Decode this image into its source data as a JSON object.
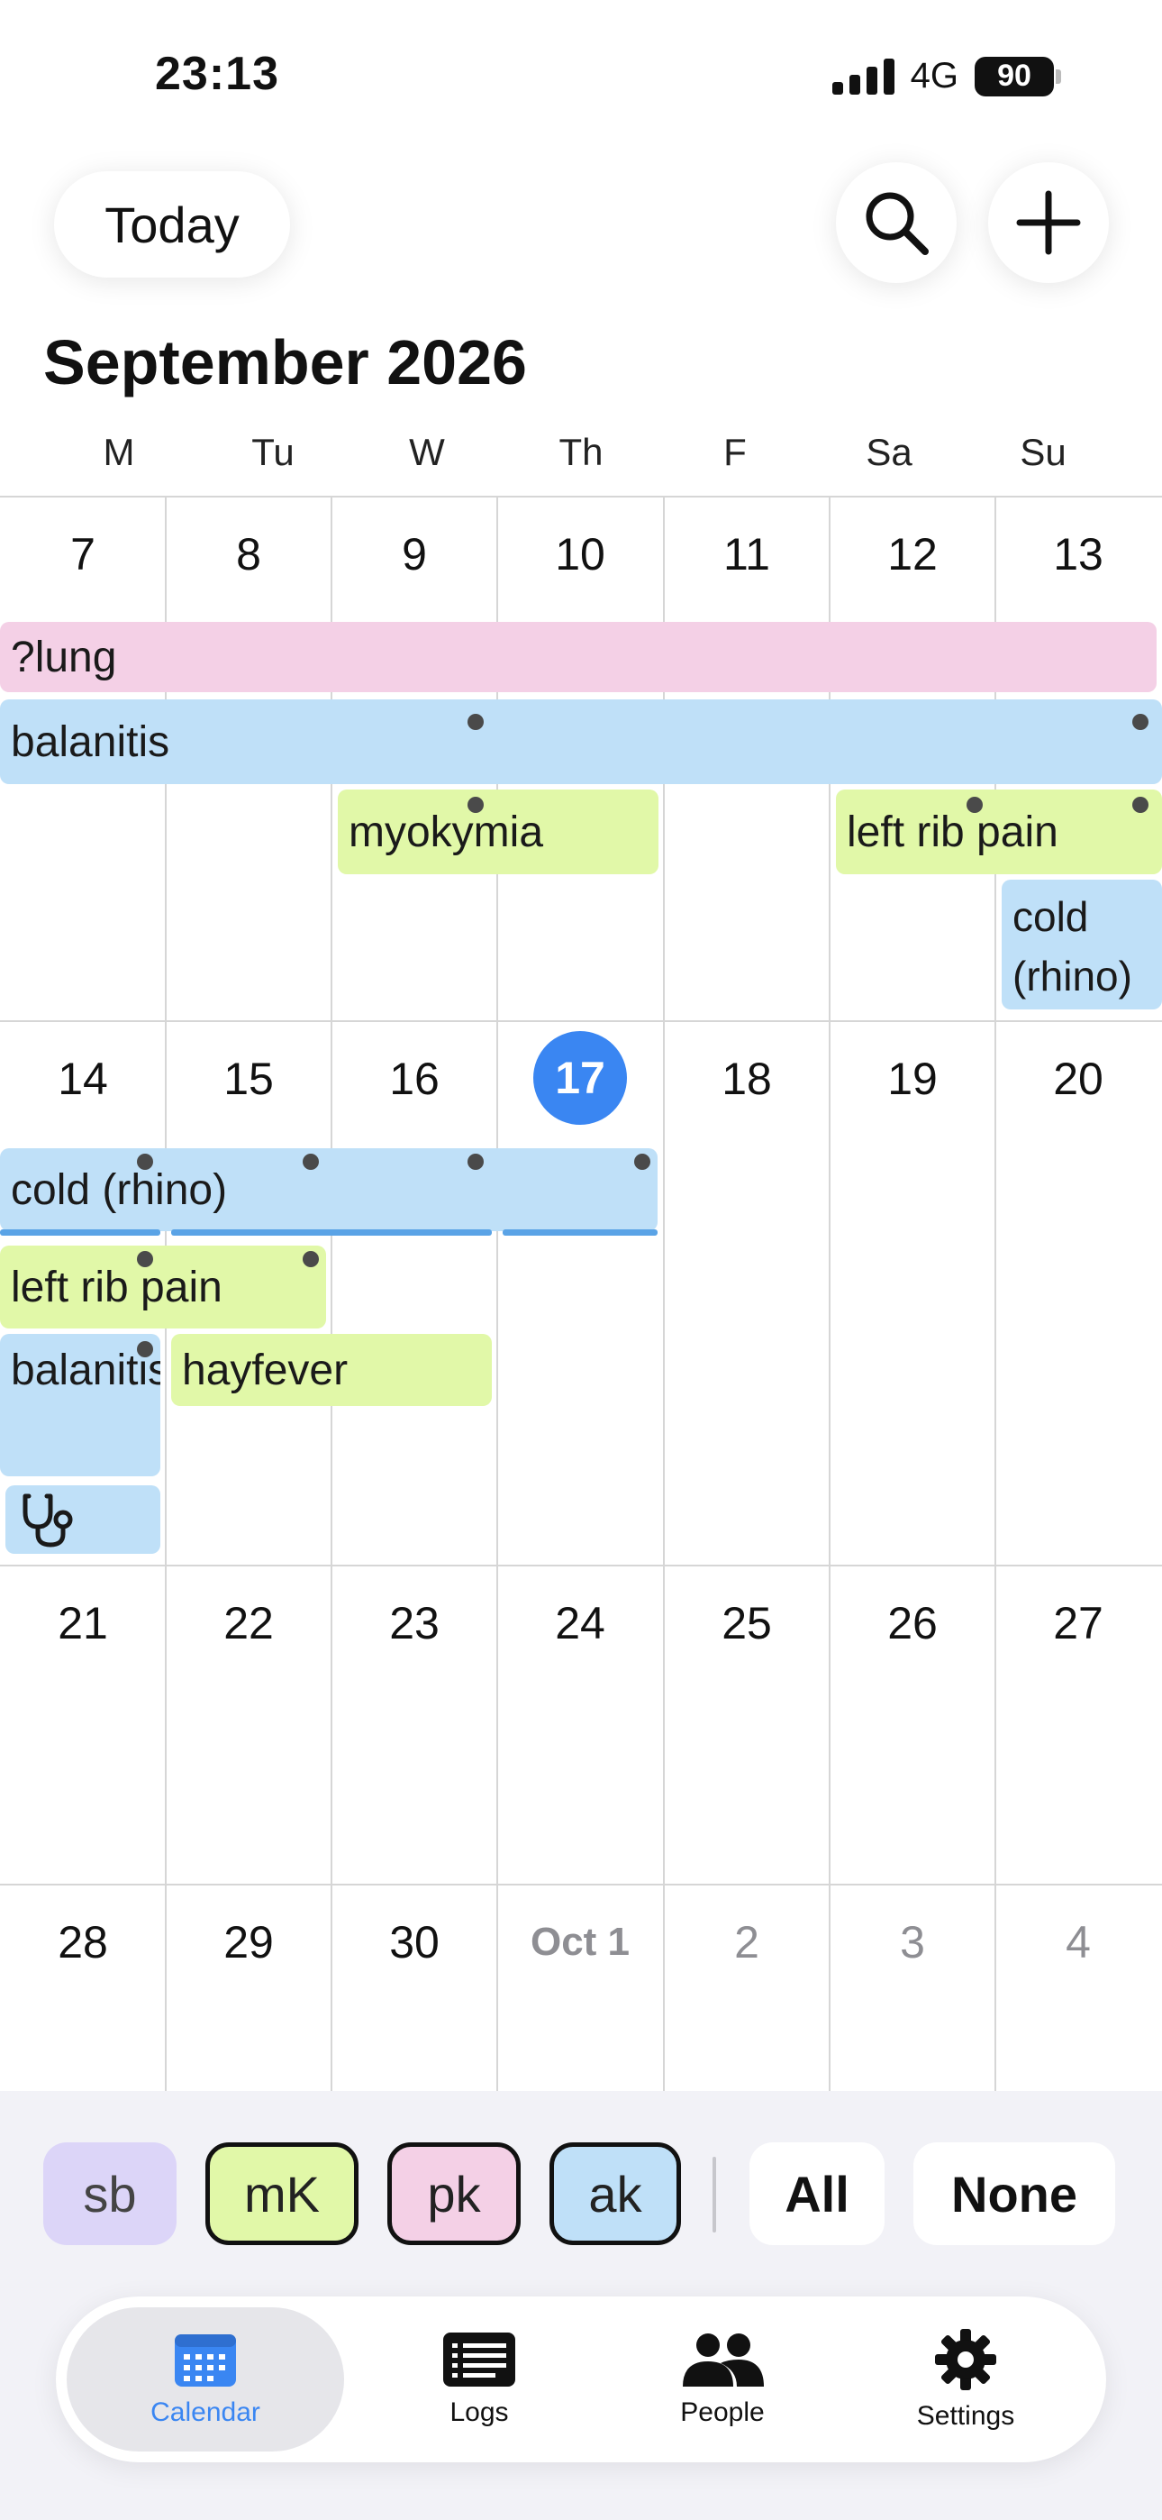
{
  "status_bar": {
    "time": "23:13",
    "network": "4G",
    "battery": "90"
  },
  "toolbar": {
    "today_label": "Today"
  },
  "calendar": {
    "title": "September 2026",
    "weekdays": [
      "M",
      "Tu",
      "W",
      "Th",
      "F",
      "Sa",
      "Su"
    ],
    "weeks": [
      [
        "7",
        "8",
        "9",
        "10",
        "11",
        "12",
        "13"
      ],
      [
        "14",
        "15",
        "16",
        "17",
        "18",
        "19",
        "20"
      ],
      [
        "21",
        "22",
        "23",
        "24",
        "25",
        "26",
        "27"
      ],
      [
        "28",
        "29",
        "30",
        "Oct 1",
        "2",
        "3",
        "4"
      ]
    ],
    "today": "17",
    "events": {
      "lung": "?lung",
      "balanitis": "balanitis",
      "myokymia": "myokymia",
      "left_rib_pain": "left rib pain",
      "cold_rhino_short": "cold (rhino)",
      "cold_rhino": "cold (rhino)",
      "left_rib_pain_2": "left rib pain",
      "balanitis_2": "balanitis",
      "hayfever": "hayfever"
    },
    "colors": {
      "pink": "#f4d0e6",
      "blue": "#bfe0f8",
      "green": "#e1f8a8",
      "today": "#3a86f2"
    }
  },
  "filters": {
    "people": [
      {
        "label": "sb",
        "color": "#dcd5f8",
        "selected": false
      },
      {
        "label": "mK",
        "color": "#e1f8a8",
        "selected": true
      },
      {
        "label": "pk",
        "color": "#f4d0e6",
        "selected": true
      },
      {
        "label": "ak",
        "color": "#bfe0f8",
        "selected": true
      }
    ],
    "all_label": "All",
    "none_label": "None"
  },
  "tabs": [
    {
      "label": "Calendar",
      "icon": "calendar-icon",
      "active": true
    },
    {
      "label": "Logs",
      "icon": "list-icon",
      "active": false
    },
    {
      "label": "People",
      "icon": "people-icon",
      "active": false
    },
    {
      "label": "Settings",
      "icon": "gear-icon",
      "active": false
    }
  ]
}
